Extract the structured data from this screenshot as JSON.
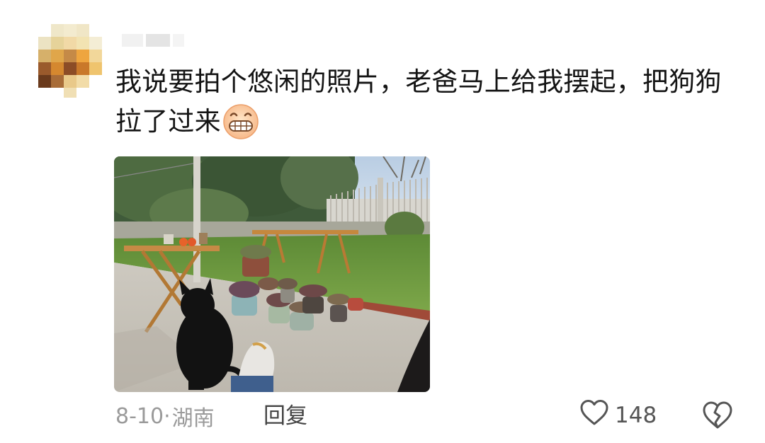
{
  "comment": {
    "username": "",
    "text": "我说要拍个悠闲的照片，老爸马上给我摆起，把狗狗拉了过来",
    "emoji": "grinning-face-icon",
    "date": "8-10",
    "separator": "·",
    "location": "湖南",
    "reply_label": "回复",
    "like_count": "148"
  },
  "colors": {
    "text": "#141414",
    "meta": "#9a9a9a",
    "icon": "#555555"
  }
}
